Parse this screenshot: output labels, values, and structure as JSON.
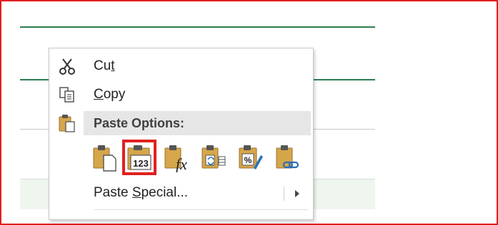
{
  "context_menu": {
    "cut": {
      "label_before": "Cu",
      "label_underline": "t",
      "icon": "scissors-icon"
    },
    "copy": {
      "label_underline": "C",
      "label_after": "opy",
      "icon": "copy-icon"
    },
    "paste_options": {
      "label": "Paste Options:",
      "icon": "clipboard-icon"
    },
    "paste_buttons": [
      {
        "name": "paste",
        "icon": "paste-icon"
      },
      {
        "name": "values",
        "icon": "paste-values-icon",
        "glyph": "123",
        "selected": true
      },
      {
        "name": "formulas",
        "icon": "paste-formulas-icon",
        "glyph": "fx"
      },
      {
        "name": "transpose",
        "icon": "paste-transpose-icon"
      },
      {
        "name": "formatting",
        "icon": "paste-formatting-icon",
        "glyph": "%"
      },
      {
        "name": "link",
        "icon": "paste-link-icon"
      }
    ],
    "paste_special": {
      "label_before": "Paste ",
      "label_underline": "S",
      "label_after": "pecial...",
      "icon": "submenu-arrow-icon"
    }
  },
  "colors": {
    "highlight": "#e02020",
    "sheet_green": "#2e7d4f",
    "clipboard_tan": "#d6a64a"
  }
}
